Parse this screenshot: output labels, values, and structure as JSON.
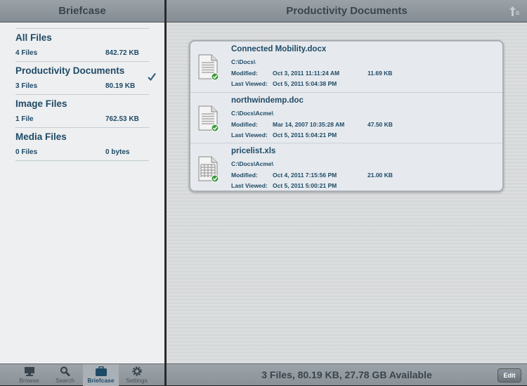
{
  "sidebar": {
    "title": "Briefcase",
    "categories": [
      {
        "title": "All Files",
        "count": "4 Files",
        "size": "842.72 KB"
      },
      {
        "title": "Productivity Documents",
        "count": "3 Files",
        "size": "80.19 KB",
        "selected": true
      },
      {
        "title": "Image Files",
        "count": "1 File",
        "size": "762.53 KB"
      },
      {
        "title": "Media Files",
        "count": "0 Files",
        "size": "0 bytes"
      }
    ]
  },
  "tabs": [
    {
      "label": "Browse"
    },
    {
      "label": "Search"
    },
    {
      "label": "Briefcase",
      "selected": true
    },
    {
      "label": "Settings"
    }
  ],
  "main": {
    "title": "Productivity Documents",
    "status": "3 Files, 80.19 KB, 27.78 GB Available",
    "edit_label": "Edit",
    "modified_label": "Modified:",
    "viewed_label": "Last Viewed:",
    "files": [
      {
        "name": "Connected Mobility.docx",
        "path": "C:\\Docs\\",
        "modified": "Oct 3, 2011 11:11:24 AM",
        "size": "11.69 KB",
        "viewed": "Oct 5, 2011 5:04:38 PM",
        "type": "doc"
      },
      {
        "name": "northwindemp.doc",
        "path": "C:\\Docs\\Acme\\",
        "modified": "Mar 14, 2007 10:35:28 AM",
        "size": "47.50 KB",
        "viewed": "Oct 5, 2011 5:04:21 PM",
        "type": "doc"
      },
      {
        "name": "pricelist.xls",
        "path": "C:\\Docs\\Acme\\",
        "modified": "Oct 4, 2011 7:15:56 PM",
        "size": "21.00 KB",
        "viewed": "Oct 5, 2011 5:00:21 PM",
        "type": "xls"
      }
    ]
  },
  "colors": {
    "accent": "#1f4a66",
    "bar": "#8f979d"
  }
}
